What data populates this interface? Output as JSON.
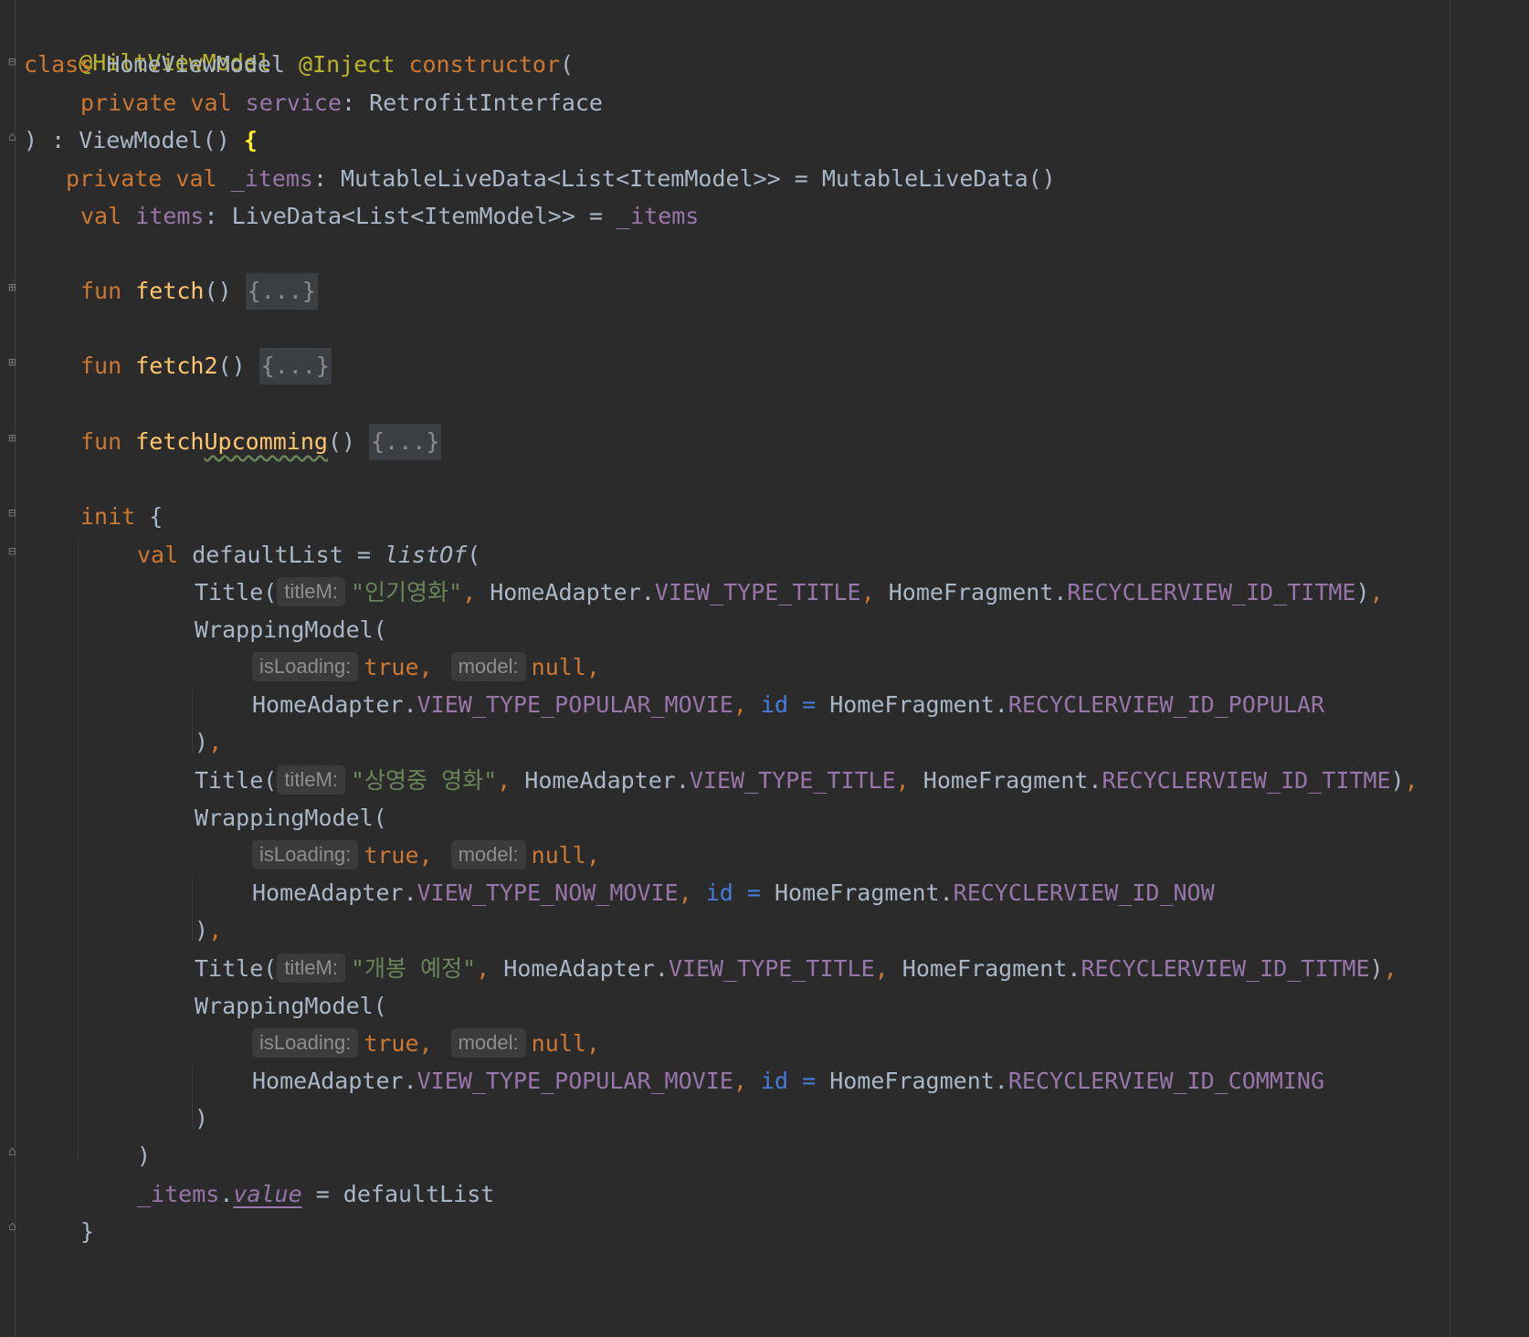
{
  "code": {
    "l1": {
      "annotation": "@HiltViewModel"
    },
    "l2": {
      "kw_class": "class",
      "class_name": " HomeViewModel ",
      "inject": "@Inject",
      "kw_constructor": " constructor",
      "paren": "("
    },
    "l3": {
      "kw_private": "private val",
      "sp": " ",
      "field": "service",
      "rest": ": RetrofitInterface"
    },
    "l4": {
      "start": ") : ViewModel() ",
      "brace": "{"
    },
    "l5": {
      "kw": "private val",
      "sp": " ",
      "field": "_items",
      "rest": ": MutableLiveData<List<ItemModel>> = MutableLiveData()"
    },
    "l6": {
      "kw": "val",
      "sp": " ",
      "field": "items",
      "mid": ": LiveData<List<ItemModel>> = ",
      "field2": "_items"
    },
    "l7": {
      "kw": "fun",
      "sp": " ",
      "fn": "fetch",
      "paren": "() ",
      "fold": "{...}"
    },
    "l8": {
      "kw": "fun",
      "sp": " ",
      "fn": "fetch2",
      "paren": "() ",
      "fold": "{...}"
    },
    "l9": {
      "kw": "fun",
      "sp": " ",
      "fn_a": "fetch",
      "fn_b": "Upcomming",
      "paren": "() ",
      "fold": "{...}"
    },
    "l10": {
      "kw": "init",
      "rest": " {"
    },
    "l11": {
      "kw": "val",
      "mid": " defaultList = ",
      "fn": "listOf",
      "paren": "("
    },
    "l12": {
      "a": "Title(",
      "hint": "titleM:",
      "str": "\"인기영화\"",
      "c1": ", ",
      "b": "HomeAdapter.",
      "k1": "VIEW_TYPE_TITLE",
      "c2": ", ",
      "d": "HomeFragment.",
      "k2": "RECYCLERVIEW_ID_TITME",
      "e": ")",
      "c3": ","
    },
    "l13": {
      "a": "WrappingModel("
    },
    "l14": {
      "hint1": "isLoading:",
      "v1": "true",
      "c1": ",",
      "hint2": "model:",
      "v2": "null",
      "c2": ","
    },
    "l15": {
      "a": "HomeAdapter.",
      "k1": "VIEW_TYPE_POPULAR_MOVIE",
      "c1": ", ",
      "named": "id = ",
      "b": "HomeFragment.",
      "k2": "RECYCLERVIEW_ID_POPULAR"
    },
    "l16": {
      "a": ")",
      "c": ","
    },
    "l17": {
      "a": "Title(",
      "hint": "titleM:",
      "str": "\"상영중 영화\"",
      "c1": ", ",
      "b": "HomeAdapter.",
      "k1": "VIEW_TYPE_TITLE",
      "c2": ", ",
      "d": "HomeFragment.",
      "k2": "RECYCLERVIEW_ID_TITME",
      "e": ")",
      "c3": ","
    },
    "l18": {
      "a": "WrappingModel("
    },
    "l19": {
      "hint1": "isLoading:",
      "v1": "true",
      "c1": ",",
      "hint2": "model:",
      "v2": "null",
      "c2": ","
    },
    "l20": {
      "a": "HomeAdapter.",
      "k1": "VIEW_TYPE_NOW_MOVIE",
      "c1": ", ",
      "named": "id = ",
      "b": "HomeFragment.",
      "k2": "RECYCLERVIEW_ID_NOW"
    },
    "l21": {
      "a": ")",
      "c": ","
    },
    "l22": {
      "a": "Title(",
      "hint": "titleM:",
      "str": "\"개봉 예정\"",
      "c1": ", ",
      "b": "HomeAdapter.",
      "k1": "VIEW_TYPE_TITLE",
      "c2": ", ",
      "d": "HomeFragment.",
      "k2": "RECYCLERVIEW_ID_TITME",
      "e": ")",
      "c3": ","
    },
    "l23": {
      "a": "WrappingModel("
    },
    "l24": {
      "hint1": "isLoading:",
      "v1": "true",
      "c1": ",",
      "hint2": "model:",
      "v2": "null",
      "c2": ","
    },
    "l25": {
      "a": "HomeAdapter.",
      "k1": "VIEW_TYPE_POPULAR_MOVIE",
      "c1": ", ",
      "named": "id = ",
      "b": "HomeFragment.",
      "k2": "RECYCLERVIEW_ID_COMMING"
    },
    "l26": {
      "a": ")"
    },
    "l27": {
      "a": ")"
    },
    "l28": {
      "field": "_items",
      "dot": ".",
      "prop": "value",
      "rest": " = defaultList"
    },
    "l29": {
      "a": "}"
    }
  },
  "colors": {
    "background": "#2b2b2b",
    "keyword": "#cc7832",
    "annotation": "#bbb529",
    "function": "#ffc66d",
    "field": "#9876aa",
    "string": "#6a8759",
    "named_arg": "#467cda",
    "default_text": "#a9b7c6"
  },
  "icons": {
    "fold_open": "fold-collapse-icon",
    "fold_closed": "fold-expand-icon",
    "fold_end": "fold-end-icon"
  }
}
